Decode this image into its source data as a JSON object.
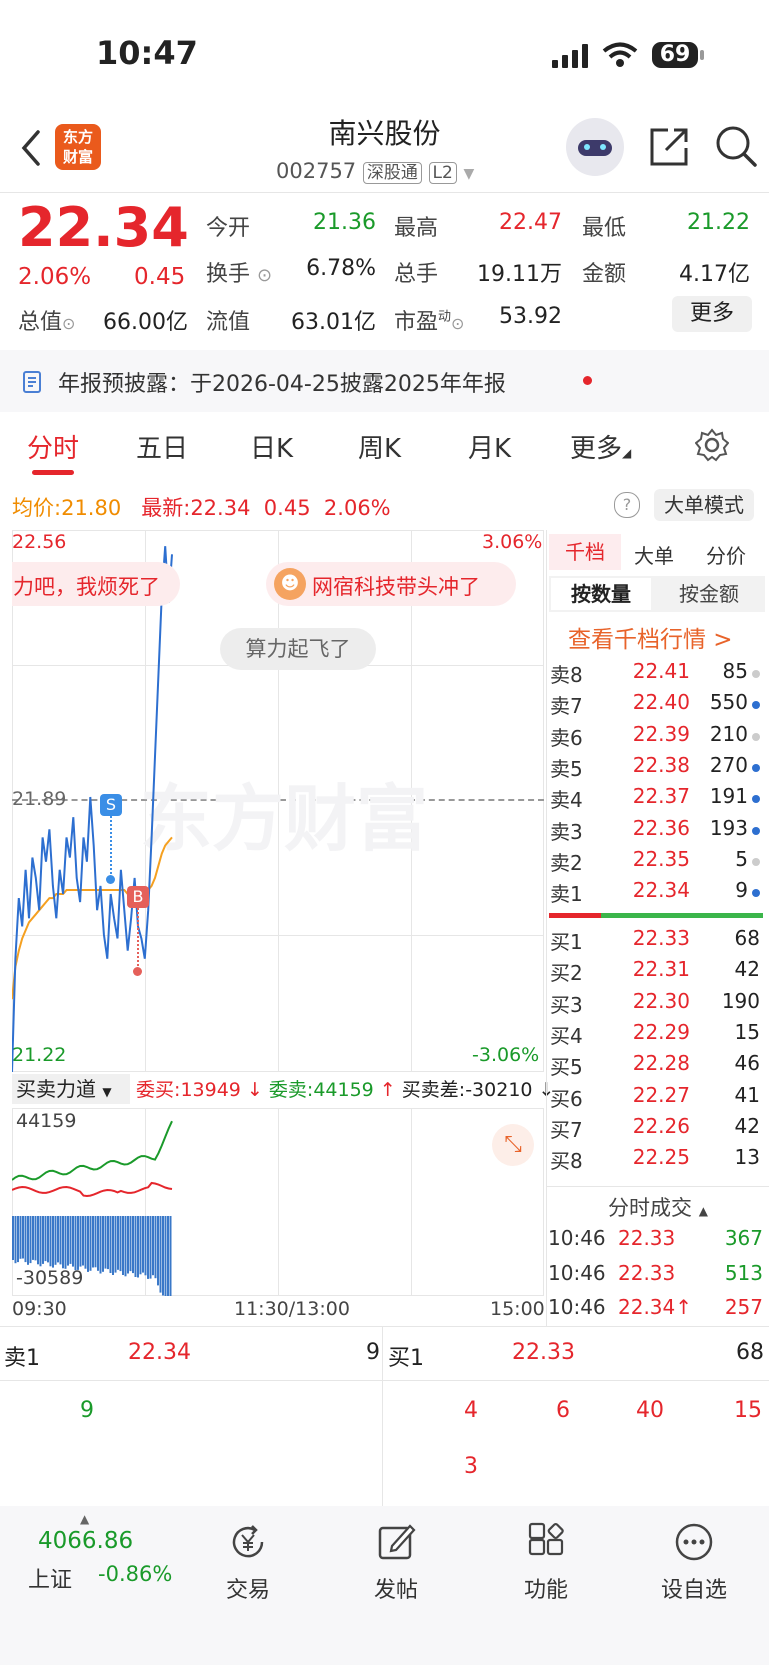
{
  "status_bar": {
    "time": "10:47",
    "battery": "69"
  },
  "header": {
    "title": "南兴股份",
    "code": "002757",
    "tag_market": "深股通",
    "tag_level": "L2",
    "logo_line1": "东方",
    "logo_line2": "财富"
  },
  "quote": {
    "price": "22.34",
    "change_pct": "2.06%",
    "change": "0.45",
    "open_label": "今开",
    "open": "21.36",
    "high_label": "最高",
    "high": "22.47",
    "low_label": "最低",
    "low": "21.22",
    "turnover_label": "换手",
    "turnover": "6.78%",
    "volume_label": "总手",
    "volume": "19.11万",
    "amount_label": "金额",
    "amount": "4.17亿",
    "mcap_label": "总值",
    "mcap": "66.00亿",
    "float_label": "流值",
    "float": "63.01亿",
    "pe_label": "市盈",
    "pe_sup": "动",
    "pe": "53.92",
    "more_button": "更多"
  },
  "notice": {
    "text": "年报预披露：于2026-04-25披露2025年年报"
  },
  "tabs": [
    "分时",
    "五日",
    "日K",
    "周K",
    "月K",
    "更多"
  ],
  "chart_info": {
    "avg_label": "均价:",
    "avg": "21.80",
    "latest_label": "最新:",
    "latest": "22.34",
    "latest_change": "0.45",
    "latest_pct": "2.06%",
    "mode_button": "大单模式"
  },
  "chart_data": {
    "type": "line",
    "y_top": "22.56",
    "y_mid": "21.89",
    "y_bottom": "21.22",
    "pct_top": "3.06%",
    "pct_bottom": "-3.06%",
    "ylim": [
      21.22,
      22.56
    ],
    "x_labels": [
      "09:30",
      "11:30/13:00",
      "15:00"
    ],
    "price_series": [
      21.22,
      21.5,
      21.65,
      21.58,
      21.72,
      21.6,
      21.75,
      21.7,
      21.62,
      21.8,
      21.74,
      21.82,
      21.68,
      21.6,
      21.72,
      21.66,
      21.8,
      21.75,
      21.85,
      21.7,
      21.64,
      21.8,
      21.74,
      21.9,
      21.78,
      21.62,
      21.68,
      21.56,
      21.5,
      21.66,
      21.6,
      21.55,
      21.72,
      21.62,
      21.52,
      21.6,
      21.7,
      21.58,
      21.55,
      21.5,
      21.62,
      21.8,
      22.0,
      22.2,
      22.4,
      22.52,
      22.38,
      22.5
    ],
    "avg_series": [
      21.4,
      21.48,
      21.52,
      21.55,
      21.57,
      21.59,
      21.6,
      21.61,
      21.62,
      21.63,
      21.64,
      21.65,
      21.65,
      21.66,
      21.66,
      21.66,
      21.67,
      21.67,
      21.67,
      21.67,
      21.67,
      21.67,
      21.67,
      21.67,
      21.67,
      21.67,
      21.67,
      21.67,
      21.67,
      21.67,
      21.67,
      21.67,
      21.67,
      21.67,
      21.66,
      21.66,
      21.66,
      21.66,
      21.66,
      21.66,
      21.67,
      21.68,
      21.7,
      21.73,
      21.76,
      21.78,
      21.79,
      21.8
    ],
    "markers": [
      {
        "label": "S",
        "color": "#3a8ee6"
      },
      {
        "label": "B",
        "color": "#e5605a"
      }
    ],
    "bubbles": [
      "力吧，我烦死了",
      "网宿科技带头冲了",
      "算力起飞了"
    ],
    "watermark": "东方财富"
  },
  "indicator": {
    "name": "买卖力道",
    "buy_label": "委买:",
    "buy": "13949",
    "sell_label": "委卖:",
    "sell": "44159",
    "diff_label": "买卖差:",
    "diff": "-30210",
    "y_top": "44159",
    "y_bottom": "-30589"
  },
  "orderbook_tabs": [
    "千档",
    "大单",
    "分价"
  ],
  "orderbook_subtabs": [
    "按数量",
    "按金额"
  ],
  "orderbook_link": "查看千档行情 >",
  "asks": [
    {
      "label": "卖8",
      "price": "22.41",
      "vol": "85",
      "dot": "#cccccc"
    },
    {
      "label": "卖7",
      "price": "22.40",
      "vol": "550",
      "dot": "#2d6fd0"
    },
    {
      "label": "卖6",
      "price": "22.39",
      "vol": "210",
      "dot": "#cccccc"
    },
    {
      "label": "卖5",
      "price": "22.38",
      "vol": "270",
      "dot": "#2d6fd0"
    },
    {
      "label": "卖4",
      "price": "22.37",
      "vol": "191",
      "dot": "#2d6fd0"
    },
    {
      "label": "卖3",
      "price": "22.36",
      "vol": "193",
      "dot": "#2d6fd0"
    },
    {
      "label": "卖2",
      "price": "22.35",
      "vol": "5",
      "dot": "#cccccc"
    },
    {
      "label": "卖1",
      "price": "22.34",
      "vol": "9",
      "dot": "#2d6fd0"
    }
  ],
  "bids": [
    {
      "label": "买1",
      "price": "22.33",
      "vol": "68"
    },
    {
      "label": "买2",
      "price": "22.31",
      "vol": "42"
    },
    {
      "label": "买3",
      "price": "22.30",
      "vol": "190"
    },
    {
      "label": "买4",
      "price": "22.29",
      "vol": "15"
    },
    {
      "label": "买5",
      "price": "22.28",
      "vol": "46"
    },
    {
      "label": "买6",
      "price": "22.27",
      "vol": "41"
    },
    {
      "label": "买7",
      "price": "22.26",
      "vol": "42"
    },
    {
      "label": "买8",
      "price": "22.25",
      "vol": "13"
    }
  ],
  "ticks_title": "分时成交",
  "ticks": [
    {
      "time": "10:46",
      "price": "22.33",
      "vol": "367",
      "vol_color": "#1a9a2a"
    },
    {
      "time": "10:46",
      "price": "22.33",
      "vol": "513",
      "vol_color": "#1a9a2a"
    },
    {
      "time": "10:46",
      "price": "22.34↑",
      "vol": "257",
      "vol_color": "#e5262c"
    }
  ],
  "level1": {
    "sell_label": "卖1",
    "sell_price": "22.34",
    "sell_vol": "9",
    "buy_label": "买1",
    "buy_price": "22.33",
    "buy_vol": "68",
    "sell_queue": [
      "9"
    ],
    "buy_queue_row1": [
      "4",
      "6",
      "40",
      "15"
    ],
    "buy_queue_row2": [
      "3"
    ]
  },
  "bottom_nav": {
    "index_value": "4066.86",
    "index_name": "上证",
    "index_change": "-0.86%",
    "items": [
      "交易",
      "发帖",
      "功能",
      "设自选"
    ]
  }
}
